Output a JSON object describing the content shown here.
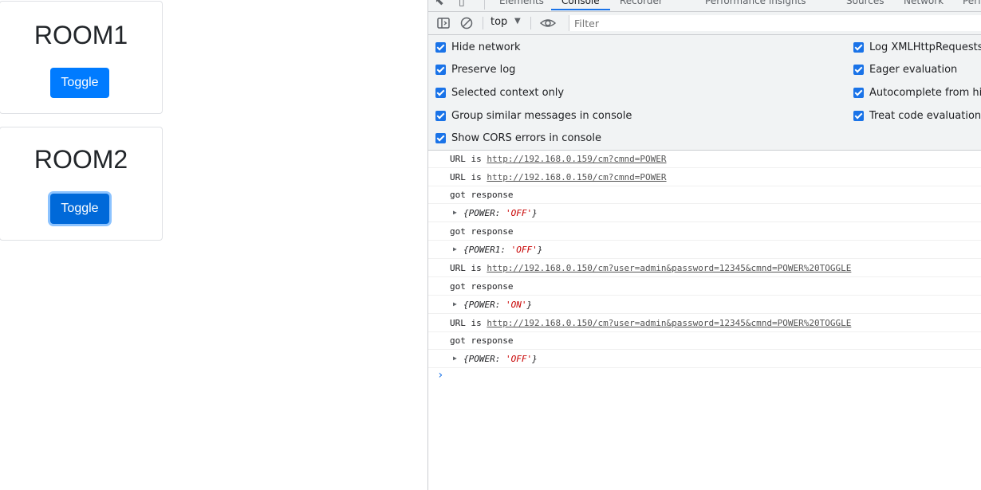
{
  "rooms": [
    {
      "title": "ROOM1",
      "button": "Toggle"
    },
    {
      "title": "ROOM2",
      "button": "Toggle"
    }
  ],
  "devtools": {
    "tabs": [
      "Elements",
      "Console",
      "Recorder",
      "Performance insights",
      "Sources",
      "Network",
      "Perf"
    ],
    "active_tab": "Console",
    "toolbar": {
      "context": "top",
      "filter_placeholder": "Filter"
    },
    "settings_left": [
      {
        "label": "Hide network",
        "checked": true
      },
      {
        "label": "Preserve log",
        "checked": true
      },
      {
        "label": "Selected context only",
        "checked": true
      },
      {
        "label": "Group similar messages in console",
        "checked": true
      },
      {
        "label": "Show CORS errors in console",
        "checked": true
      }
    ],
    "settings_right": [
      {
        "label": "Log XMLHttpRequests",
        "checked": true
      },
      {
        "label": "Eager evaluation",
        "checked": true
      },
      {
        "label": "Autocomplete from history",
        "checked": true
      },
      {
        "label": "Treat code evaluation as user action",
        "checked": true
      }
    ],
    "console": {
      "url_prefix": "URL is",
      "lines": [
        {
          "type": "url",
          "url": "http://192.168.0.159/cm?cmnd=POWER"
        },
        {
          "type": "url",
          "url": "http://192.168.0.150/cm?cmnd=POWER"
        },
        {
          "type": "text",
          "text": "got response"
        },
        {
          "type": "object",
          "key": "POWER",
          "value": "'OFF'"
        },
        {
          "type": "text",
          "text": "got response"
        },
        {
          "type": "object",
          "key": "POWER1",
          "value": "'OFF'"
        },
        {
          "type": "url",
          "url": "http://192.168.0.150/cm?user=admin&password=12345&cmnd=POWER%20TOGGLE"
        },
        {
          "type": "text",
          "text": "got response"
        },
        {
          "type": "object",
          "key": "POWER",
          "value": "'ON'"
        },
        {
          "type": "url",
          "url": "http://192.168.0.150/cm?user=admin&password=12345&cmnd=POWER%20TOGGLE"
        },
        {
          "type": "text",
          "text": "got response"
        },
        {
          "type": "object",
          "key": "POWER",
          "value": "'OFF'"
        }
      ]
    }
  }
}
